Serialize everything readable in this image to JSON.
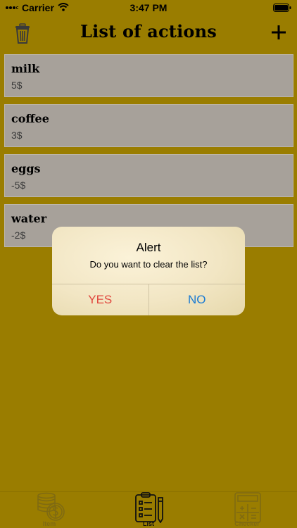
{
  "status_bar": {
    "carrier": "Carrier",
    "time": "3:47 PM"
  },
  "header": {
    "title": "List of actions",
    "left_icon": "trash-icon",
    "right_icon": "plus-icon"
  },
  "items": [
    {
      "name": "milk",
      "price": "5$"
    },
    {
      "name": "coffee",
      "price": "3$"
    },
    {
      "name": "eggs",
      "price": "-5$"
    },
    {
      "name": "water",
      "price": "-2$"
    }
  ],
  "alert": {
    "title": "Alert",
    "message": "Do you want to clear the list?",
    "yes_label": "YES",
    "no_label": "NO",
    "yes_color": "#e0463c",
    "no_color": "#1b7bd3"
  },
  "tabs": [
    {
      "label": "Item",
      "icon": "coins-icon"
    },
    {
      "label": "List",
      "icon": "clipboard-list-icon",
      "active": true
    },
    {
      "label": "Checker",
      "icon": "calculator-icon"
    }
  ],
  "colors": {
    "background": "#9a7d00",
    "row": "#a7a19a"
  }
}
